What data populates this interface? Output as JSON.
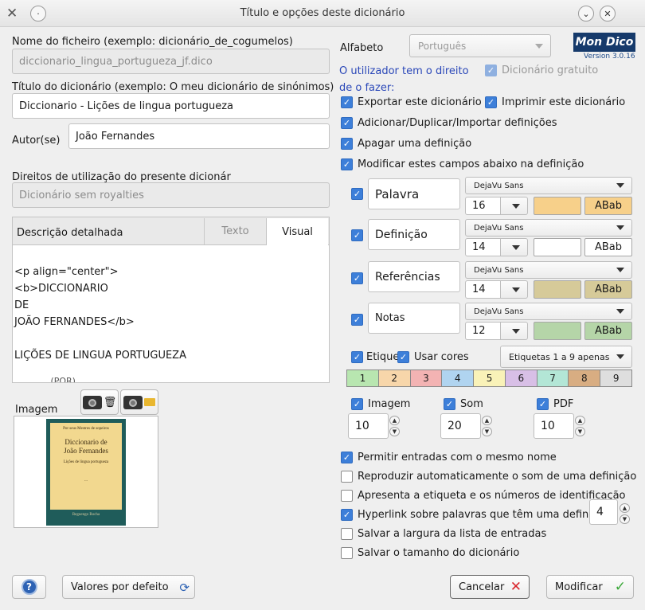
{
  "window": {
    "title": "Título e opções deste dicionário"
  },
  "left": {
    "filename_label": "Nome do ficheiro (exemplo: dicionário_de_cogumelos)",
    "filename_value": "diccionario_lingua_portugueza_jf.dico",
    "title_label": "Título do dicionário (exemplo: O meu dicionário de sinónimos)",
    "title_value": "Diccionario - Lições de lingua portugueza",
    "author_label": "Autor(se)",
    "author_value": "João Fernandes",
    "rights_label": "Direitos de utilização do presente dicionár",
    "rights_value": "Dicionário sem royalties",
    "desc_label": "Descrição detalhada",
    "tab_text": "Texto",
    "tab_visual": "Visual",
    "desc_lines": [
      "<p align=\"center\">",
      "<b>DICCIONARIO",
      "DE",
      "JOÃO FERNANDES</b>",
      "",
      "LIÇÕES DE LINGUA PORTUGUEZA",
      "",
      "          ...(POR)..."
    ],
    "image_label": "Imagem",
    "cover": {
      "line1": "Por seus Mestres de sopeiros",
      "line2": "Diccionario de",
      "line3": "João Fernandes",
      "line4": "Lições de lingua portugueza",
      "line5": "...",
      "line6": "Reguengo Rocha"
    }
  },
  "right": {
    "alphabet_label": "Alfabeto",
    "alphabet_value": "Português",
    "logo": "Mon Dico",
    "version": "Version 3.0.16",
    "rights_heading": "O utilizador tem o direito de o fazer:",
    "free_dict": "Dicionário gratuito",
    "export": "Exportar este dicionário",
    "print": "Imprimir este dicionário",
    "add_defs": "Adicionar/Duplicar/Importar definições",
    "delete_def": "Apagar uma definição",
    "modify_fields": "Modificar estes campos abaixo na definição",
    "fields": [
      {
        "name": "Palavra",
        "font": "DejaVu Sans",
        "size": "16",
        "color": "#f7d08a",
        "sample": "ABab",
        "sample_bg": "#f7d08a"
      },
      {
        "name": "Definição",
        "font": "DejaVu Sans",
        "size": "14",
        "color": "#ffffff",
        "sample": "ABab",
        "sample_bg": "#ffffff"
      },
      {
        "name": "Referências",
        "font": "DejaVu Sans",
        "size": "14",
        "color": "#d6ca99",
        "sample": "ABab",
        "sample_bg": "#d6ca99"
      },
      {
        "name": "Notas",
        "font": "DejaVu Sans",
        "size": "12",
        "color": "#b5d5a8",
        "sample": "ABab",
        "sample_bg": "#b5d5a8"
      }
    ],
    "tags_label": "Etique",
    "use_colors": "Usar cores",
    "tags_select": "Etiquetas 1 a 9 apenas",
    "tags": [
      {
        "n": "1",
        "c": "#b8e6b0"
      },
      {
        "n": "2",
        "c": "#f7d6aa"
      },
      {
        "n": "3",
        "c": "#f3b3b3"
      },
      {
        "n": "4",
        "c": "#b0d4f0"
      },
      {
        "n": "5",
        "c": "#f9f2b8"
      },
      {
        "n": "6",
        "c": "#d8bfe6"
      },
      {
        "n": "7",
        "c": "#b3e6d6"
      },
      {
        "n": "8",
        "c": "#d8ad82"
      },
      {
        "n": "9",
        "c": "#dedede"
      }
    ],
    "media": [
      {
        "label": "Imagem",
        "value": "10"
      },
      {
        "label": "Som",
        "value": "20"
      },
      {
        "label": "PDF",
        "value": "10"
      }
    ],
    "options": [
      {
        "label": "Permitir entradas com o mesmo nome",
        "checked": true
      },
      {
        "label": "Reproduzir automaticamente o som de uma definição",
        "checked": false
      },
      {
        "label": "Apresenta a etiqueta e os números de identificação",
        "checked": false
      },
      {
        "label": "Hyperlink sobre palavras que têm uma definição",
        "checked": true
      },
      {
        "label": "Salvar a largura da lista de entradas",
        "checked": false
      },
      {
        "label": "Salvar o tamanho do dicionário",
        "checked": false
      }
    ],
    "hyperlink_value": "4"
  },
  "footer": {
    "help": "?",
    "defaults": "Valores por defeito",
    "cancel": "Cancelar",
    "modify": "Modificar"
  }
}
